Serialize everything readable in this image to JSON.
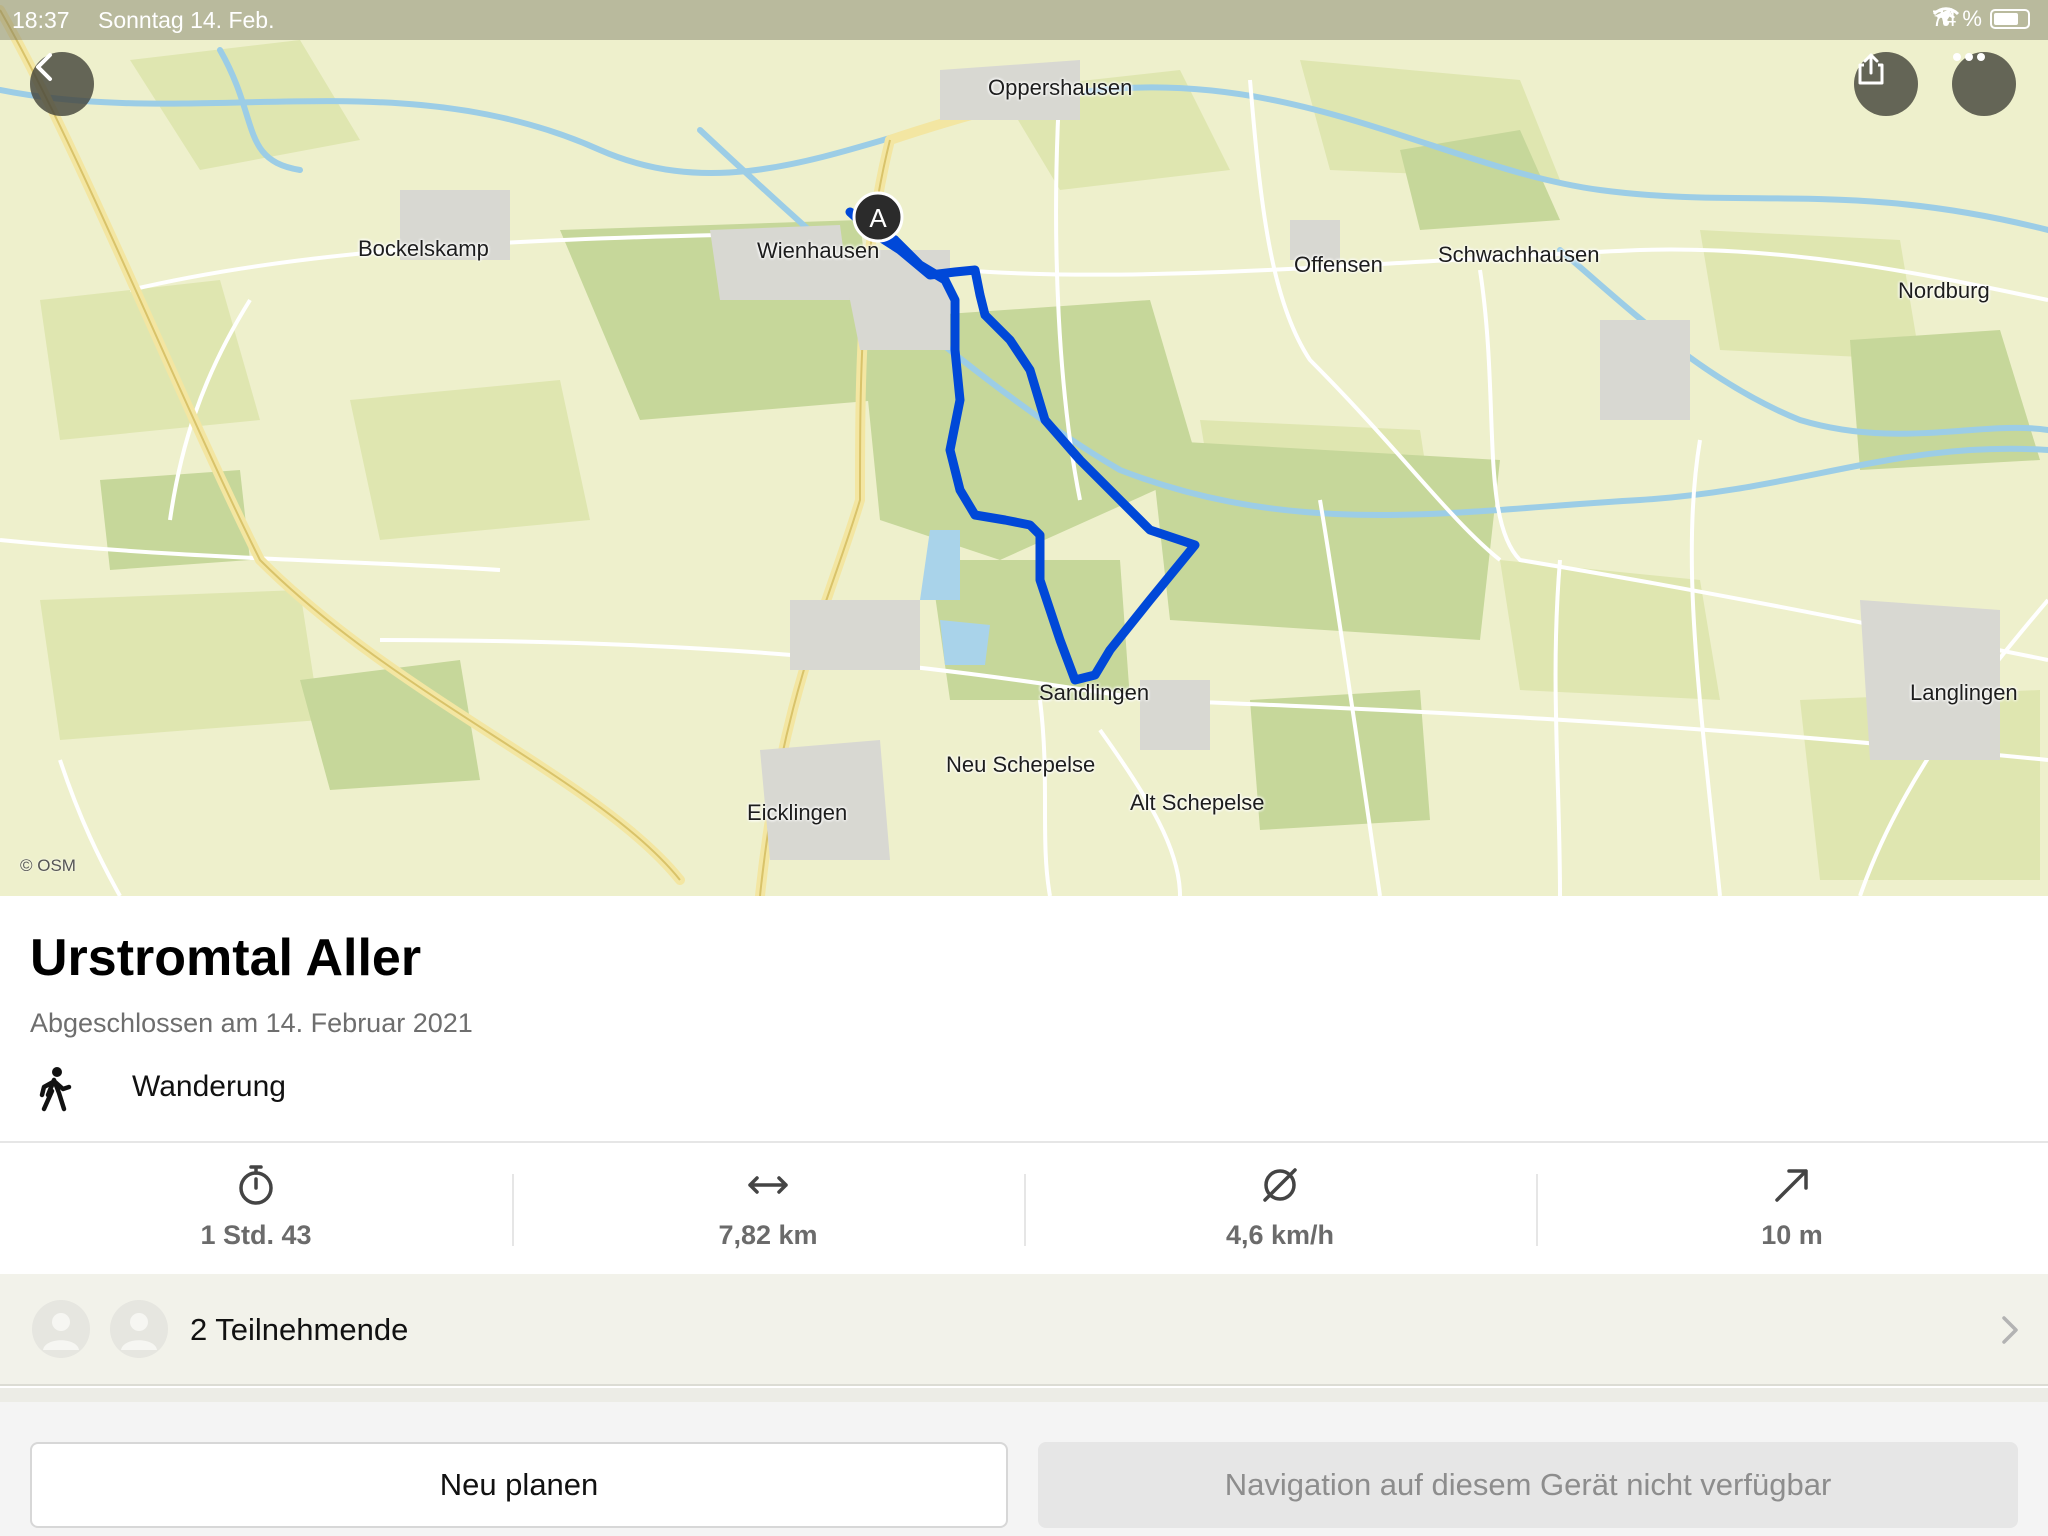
{
  "status_bar": {
    "time": "18:37",
    "date": "Sonntag 14. Feb.",
    "battery": "74 %",
    "battery_level": 0.74
  },
  "map": {
    "attribution": "© OSM",
    "start_marker": "A",
    "route_color": "#0048d8",
    "places": {
      "oppershausen": "Oppershausen",
      "bockelskamp": "Bockelskamp",
      "wienhausen": "Wienhausen",
      "offensen": "Offensen",
      "schwachhausen": "Schwachhausen",
      "nordburg": "Nordburg",
      "sandlingen": "Sandlingen",
      "langlingen": "Langlingen",
      "neu_schepelse": "Neu Schepelse",
      "alt_schepelse": "Alt Schepelse",
      "eicklingen": "Eicklingen"
    }
  },
  "tour": {
    "title": "Urstromtal Aller",
    "completed": "Abgeschlossen am 14. Februar 2021",
    "activity": "Wanderung"
  },
  "stats": {
    "duration": "1 Std. 43",
    "distance": "7,82 km",
    "speed": "4,6 km/h",
    "elevation": "10 m"
  },
  "participants": {
    "label": "2 Teilnehmende"
  },
  "actions": {
    "replan": "Neu planen",
    "navigation": "Navigation auf diesem Gerät nicht verfügbar"
  }
}
